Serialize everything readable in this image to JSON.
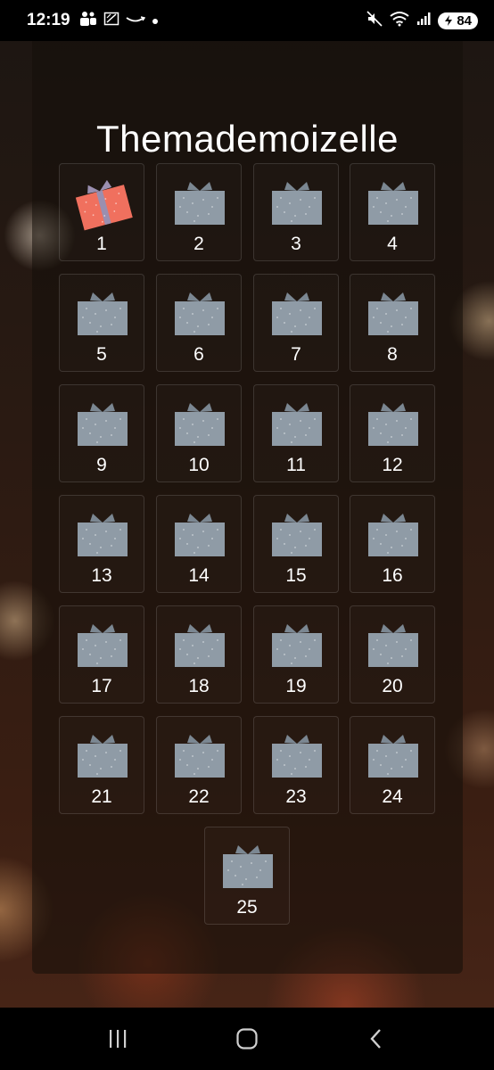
{
  "status_bar": {
    "time": "12:19",
    "battery": "84",
    "icons": [
      "teams-icon",
      "sketch-icon",
      "amazon-icon",
      "dot-icon",
      "mute-icon",
      "wifi-icon",
      "signal-icon",
      "battery-icon"
    ]
  },
  "page": {
    "title": "Themademoizelle"
  },
  "calendar": {
    "days": [
      {
        "label": "1",
        "opened": true
      },
      {
        "label": "2",
        "opened": false
      },
      {
        "label": "3",
        "opened": false
      },
      {
        "label": "4",
        "opened": false
      },
      {
        "label": "5",
        "opened": false
      },
      {
        "label": "6",
        "opened": false
      },
      {
        "label": "7",
        "opened": false
      },
      {
        "label": "8",
        "opened": false
      },
      {
        "label": "9",
        "opened": false
      },
      {
        "label": "10",
        "opened": false
      },
      {
        "label": "11",
        "opened": false
      },
      {
        "label": "12",
        "opened": false
      },
      {
        "label": "13",
        "opened": false
      },
      {
        "label": "14",
        "opened": false
      },
      {
        "label": "15",
        "opened": false
      },
      {
        "label": "16",
        "opened": false
      },
      {
        "label": "17",
        "opened": false
      },
      {
        "label": "18",
        "opened": false
      },
      {
        "label": "19",
        "opened": false
      },
      {
        "label": "20",
        "opened": false
      },
      {
        "label": "21",
        "opened": false
      },
      {
        "label": "22",
        "opened": false
      },
      {
        "label": "23",
        "opened": false
      },
      {
        "label": "24",
        "opened": false
      },
      {
        "label": "25",
        "opened": false
      }
    ],
    "colors": {
      "gift_closed": "#8f9ba6",
      "gift_closed_ribbon": "#7b8792",
      "gift_opened": "#f0705e",
      "gift_opened_ribbon": "#9a8fb0"
    }
  },
  "nav_bar": {
    "icons": [
      "recents-icon",
      "home-icon",
      "back-icon"
    ]
  }
}
